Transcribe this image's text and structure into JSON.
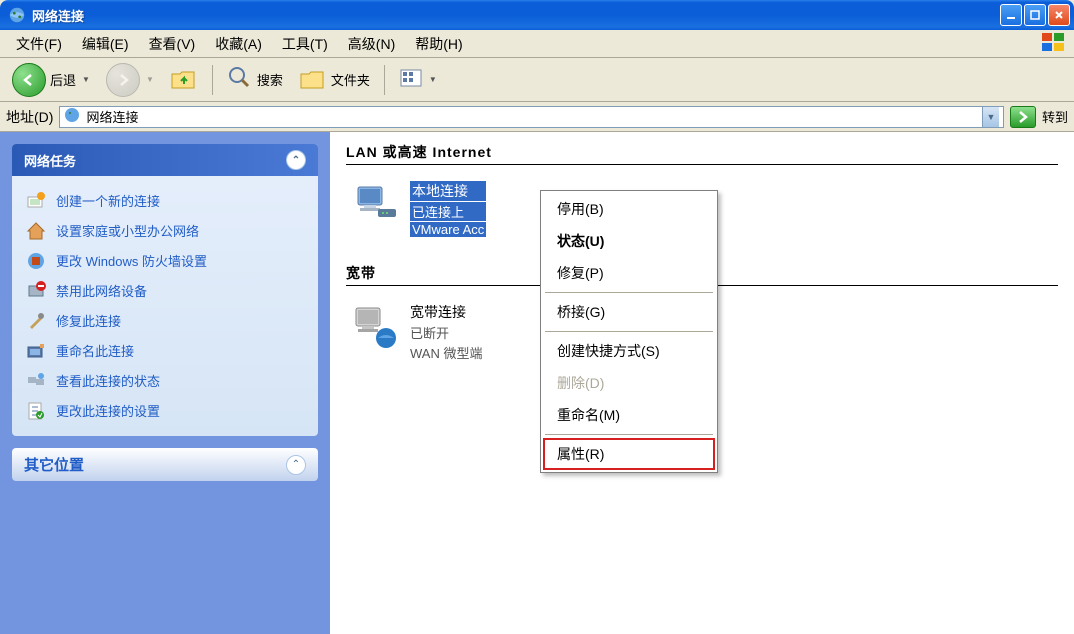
{
  "window": {
    "title": "网络连接"
  },
  "menubar": {
    "items": [
      "文件(F)",
      "编辑(E)",
      "查看(V)",
      "收藏(A)",
      "工具(T)",
      "高级(N)",
      "帮助(H)"
    ]
  },
  "toolbar": {
    "back": "后退",
    "search": "搜索",
    "folders": "文件夹"
  },
  "addressbar": {
    "label": "地址(D)",
    "value": "网络连接",
    "go": "转到"
  },
  "sidebar": {
    "panel1": {
      "title": "网络任务",
      "tasks": [
        "创建一个新的连接",
        "设置家庭或小型办公网络",
        "更改 Windows 防火墙设置",
        "禁用此网络设备",
        "修复此连接",
        "重命名此连接",
        "查看此连接的状态",
        "更改此连接的设置"
      ]
    },
    "panel2": {
      "title": "其它位置"
    }
  },
  "main": {
    "section1": "LAN 或高速 Internet",
    "conn1": {
      "title": "本地连接",
      "status": "已连接上",
      "detail": "VMware Acc"
    },
    "section2": "宽带",
    "conn2": {
      "title": "宽带连接",
      "status": "已断开",
      "detail": "WAN 微型端"
    }
  },
  "context_menu": {
    "items": [
      "停用(B)",
      "状态(U)",
      "修复(P)",
      "桥接(G)",
      "创建快捷方式(S)",
      "删除(D)",
      "重命名(M)",
      "属性(R)"
    ]
  }
}
